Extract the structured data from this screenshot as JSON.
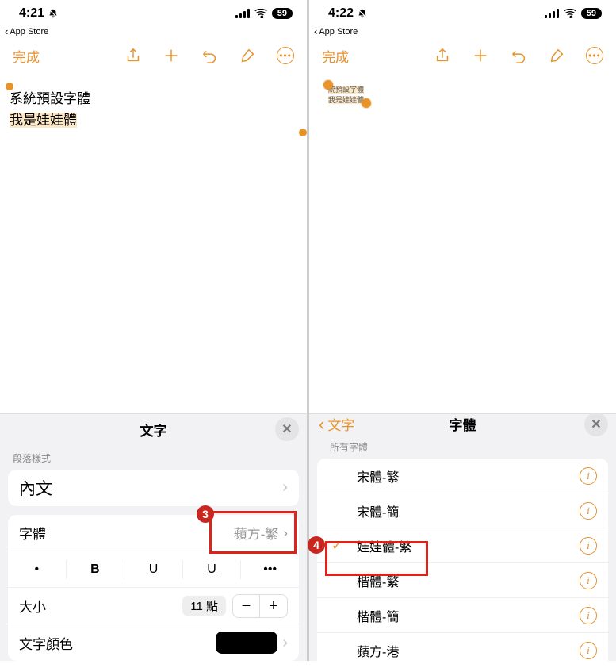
{
  "left": {
    "status": {
      "time": "4:21",
      "battery": "59"
    },
    "breadcrumb": "App Store",
    "toolbar": {
      "done": "完成"
    },
    "note": {
      "line1": "系統預設字體",
      "line2": "我是娃娃體"
    },
    "sheet": {
      "title": "文字",
      "section_label": "段落樣式",
      "paragraph_style": "內文",
      "font_label": "字體",
      "font_value": "蘋方-繁",
      "style_bullet": "•",
      "style_bold": "B",
      "style_u": "U",
      "style_s": "U",
      "style_more": "•••",
      "size_label": "大小",
      "size_value": "11 點",
      "size_minus": "−",
      "size_plus": "+",
      "color_label": "文字顏色"
    },
    "callout": "3"
  },
  "right": {
    "status": {
      "time": "4:22",
      "battery": "59"
    },
    "breadcrumb": "App Store",
    "toolbar": {
      "done": "完成"
    },
    "note": {
      "line1": "統預設字體",
      "line2": "我是娃娃體"
    },
    "sheet": {
      "back_label": "文字",
      "title": "字體",
      "section_label": "所有字體",
      "items": [
        {
          "label": "宋體-繁",
          "checked": false
        },
        {
          "label": "宋體-簡",
          "checked": false
        },
        {
          "label": "娃娃體-繁",
          "checked": true
        },
        {
          "label": "楷體-繁",
          "checked": false
        },
        {
          "label": "楷體-簡",
          "checked": false
        },
        {
          "label": "蘋方-港",
          "checked": false
        }
      ]
    },
    "callout": "4"
  }
}
